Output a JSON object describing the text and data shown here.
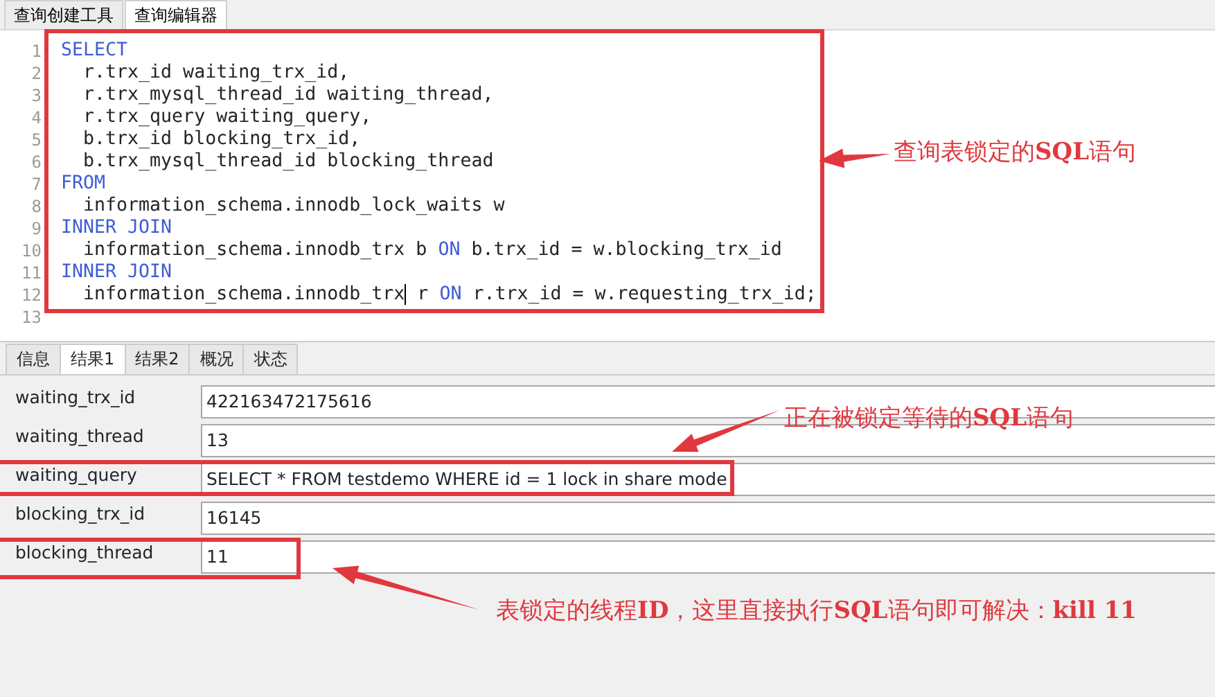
{
  "editor_tabs": [
    {
      "label": "查询创建工具",
      "selected": false
    },
    {
      "label": "查询编辑器",
      "selected": true
    }
  ],
  "editor": {
    "highlighted": true,
    "lines": [
      {
        "number": "1",
        "segments": [
          {
            "text": "SELECT",
            "kind": "keyword"
          }
        ]
      },
      {
        "number": "2",
        "segments": [
          {
            "text": "  r.trx_id waiting_trx_id,",
            "kind": "plain"
          }
        ]
      },
      {
        "number": "3",
        "segments": [
          {
            "text": "  r.trx_mysql_thread_id waiting_thread,",
            "kind": "plain"
          }
        ]
      },
      {
        "number": "4",
        "segments": [
          {
            "text": "  r.trx_query waiting_query,",
            "kind": "plain"
          }
        ]
      },
      {
        "number": "5",
        "segments": [
          {
            "text": "  b.trx_id blocking_trx_id,",
            "kind": "plain"
          }
        ]
      },
      {
        "number": "6",
        "segments": [
          {
            "text": "  b.trx_mysql_thread_id blocking_thread",
            "kind": "plain"
          }
        ]
      },
      {
        "number": "7",
        "segments": [
          {
            "text": "FROM",
            "kind": "keyword"
          }
        ]
      },
      {
        "number": "8",
        "segments": [
          {
            "text": "  information_schema.innodb_lock_waits w",
            "kind": "plain"
          }
        ]
      },
      {
        "number": "9",
        "segments": [
          {
            "text": "INNER JOIN",
            "kind": "keyword"
          }
        ]
      },
      {
        "number": "10",
        "segments": [
          {
            "text": "  information_schema.innodb_trx b ",
            "kind": "plain"
          },
          {
            "text": "ON",
            "kind": "keyword"
          },
          {
            "text": " b.trx_id = w.blocking_trx_id",
            "kind": "plain"
          }
        ]
      },
      {
        "number": "11",
        "segments": [
          {
            "text": "INNER JOIN",
            "kind": "keyword"
          }
        ]
      },
      {
        "number": "12",
        "segments": [
          {
            "text": "  information_schema.innodb_trx",
            "kind": "plain"
          },
          {
            "text": " r ",
            "kind": "plain",
            "cursor": true
          },
          {
            "text": "ON",
            "kind": "keyword"
          },
          {
            "text": " r.trx_id = w.requesting_trx_id;",
            "kind": "plain"
          }
        ]
      },
      {
        "number": "13"
      }
    ]
  },
  "result_tabs": [
    {
      "label": "信息",
      "selected": false
    },
    {
      "label": "结果1",
      "selected": true
    },
    {
      "label": "结果2",
      "selected": false
    },
    {
      "label": "概况",
      "selected": false
    },
    {
      "label": "状态",
      "selected": false
    }
  ],
  "record": [
    {
      "field": "waiting_trx_id",
      "value": "422163472175616",
      "highlighted": false
    },
    {
      "field": "waiting_thread",
      "value": "13",
      "highlighted": false
    },
    {
      "field": "waiting_query",
      "value": "SELECT * FROM testdemo WHERE id = 1 lock in share mode",
      "highlighted": true
    },
    {
      "field": "blocking_trx_id",
      "value": "16145",
      "highlighted": false
    },
    {
      "field": "blocking_thread",
      "value": "11",
      "highlighted": true
    }
  ],
  "callouts": [
    {
      "text": "查询表锁定的**SQL**语句"
    },
    {
      "text": "正在被锁定等待的**SQL**语句"
    },
    {
      "text": "表锁定的线程**ID**，这里直接执行**SQL**语句即可解决：**kill 11**"
    }
  ]
}
